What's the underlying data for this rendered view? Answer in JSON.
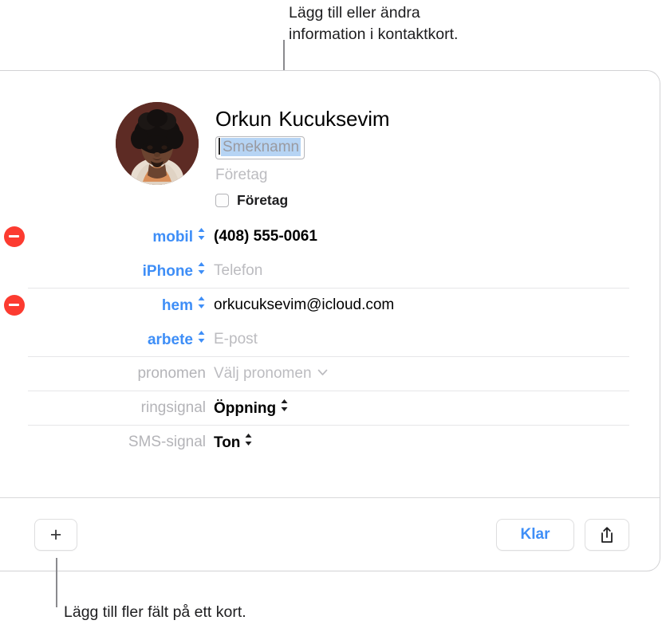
{
  "callouts": {
    "top": "Lägg till eller ändra\ninformation i kontaktkort.",
    "bottom": "Lägg till fler fält på ett kort."
  },
  "card": {
    "header": {
      "first_name": "Orkun",
      "last_name": "Kucuksevim",
      "nickname_placeholder": "Smeknamn",
      "company_placeholder": "Företag",
      "company_checkbox_label": "Företag"
    },
    "fields": [
      {
        "label": "mobil",
        "label_style": "blue",
        "value": "(408) 555-0061",
        "value_style": "strong",
        "removable": true,
        "control": "stepper"
      },
      {
        "label": "iPhone",
        "label_style": "blue",
        "value": "Telefon",
        "value_style": "muted",
        "removable": false,
        "control": "stepper"
      },
      {
        "label": "hem",
        "label_style": "blue",
        "value": "orkucuksevim@icloud.com",
        "value_style": "plain",
        "removable": true,
        "control": "stepper"
      },
      {
        "label": "arbete",
        "label_style": "blue",
        "value": "E-post",
        "value_style": "muted",
        "removable": false,
        "control": "stepper"
      },
      {
        "label": "pronomen",
        "label_style": "gray",
        "value": "Välj pronomen",
        "value_style": "muted",
        "removable": false,
        "control": "chevron"
      },
      {
        "label": "ringsignal",
        "label_style": "gray",
        "value": "Öppning",
        "value_style": "strong",
        "removable": false,
        "control": "value-stepper"
      },
      {
        "label": "SMS-signal",
        "label_style": "gray",
        "value": "Ton",
        "value_style": "strong",
        "removable": false,
        "control": "value-stepper"
      }
    ],
    "toolbar": {
      "add_label": "+",
      "done_label": "Klar",
      "share_icon": "share-icon"
    }
  },
  "colors": {
    "accent_blue": "#3e8ef7",
    "delete_red": "#fc3b30",
    "placeholder_gray": "#bcbcc0",
    "selection_blue": "#b6d4f4"
  }
}
